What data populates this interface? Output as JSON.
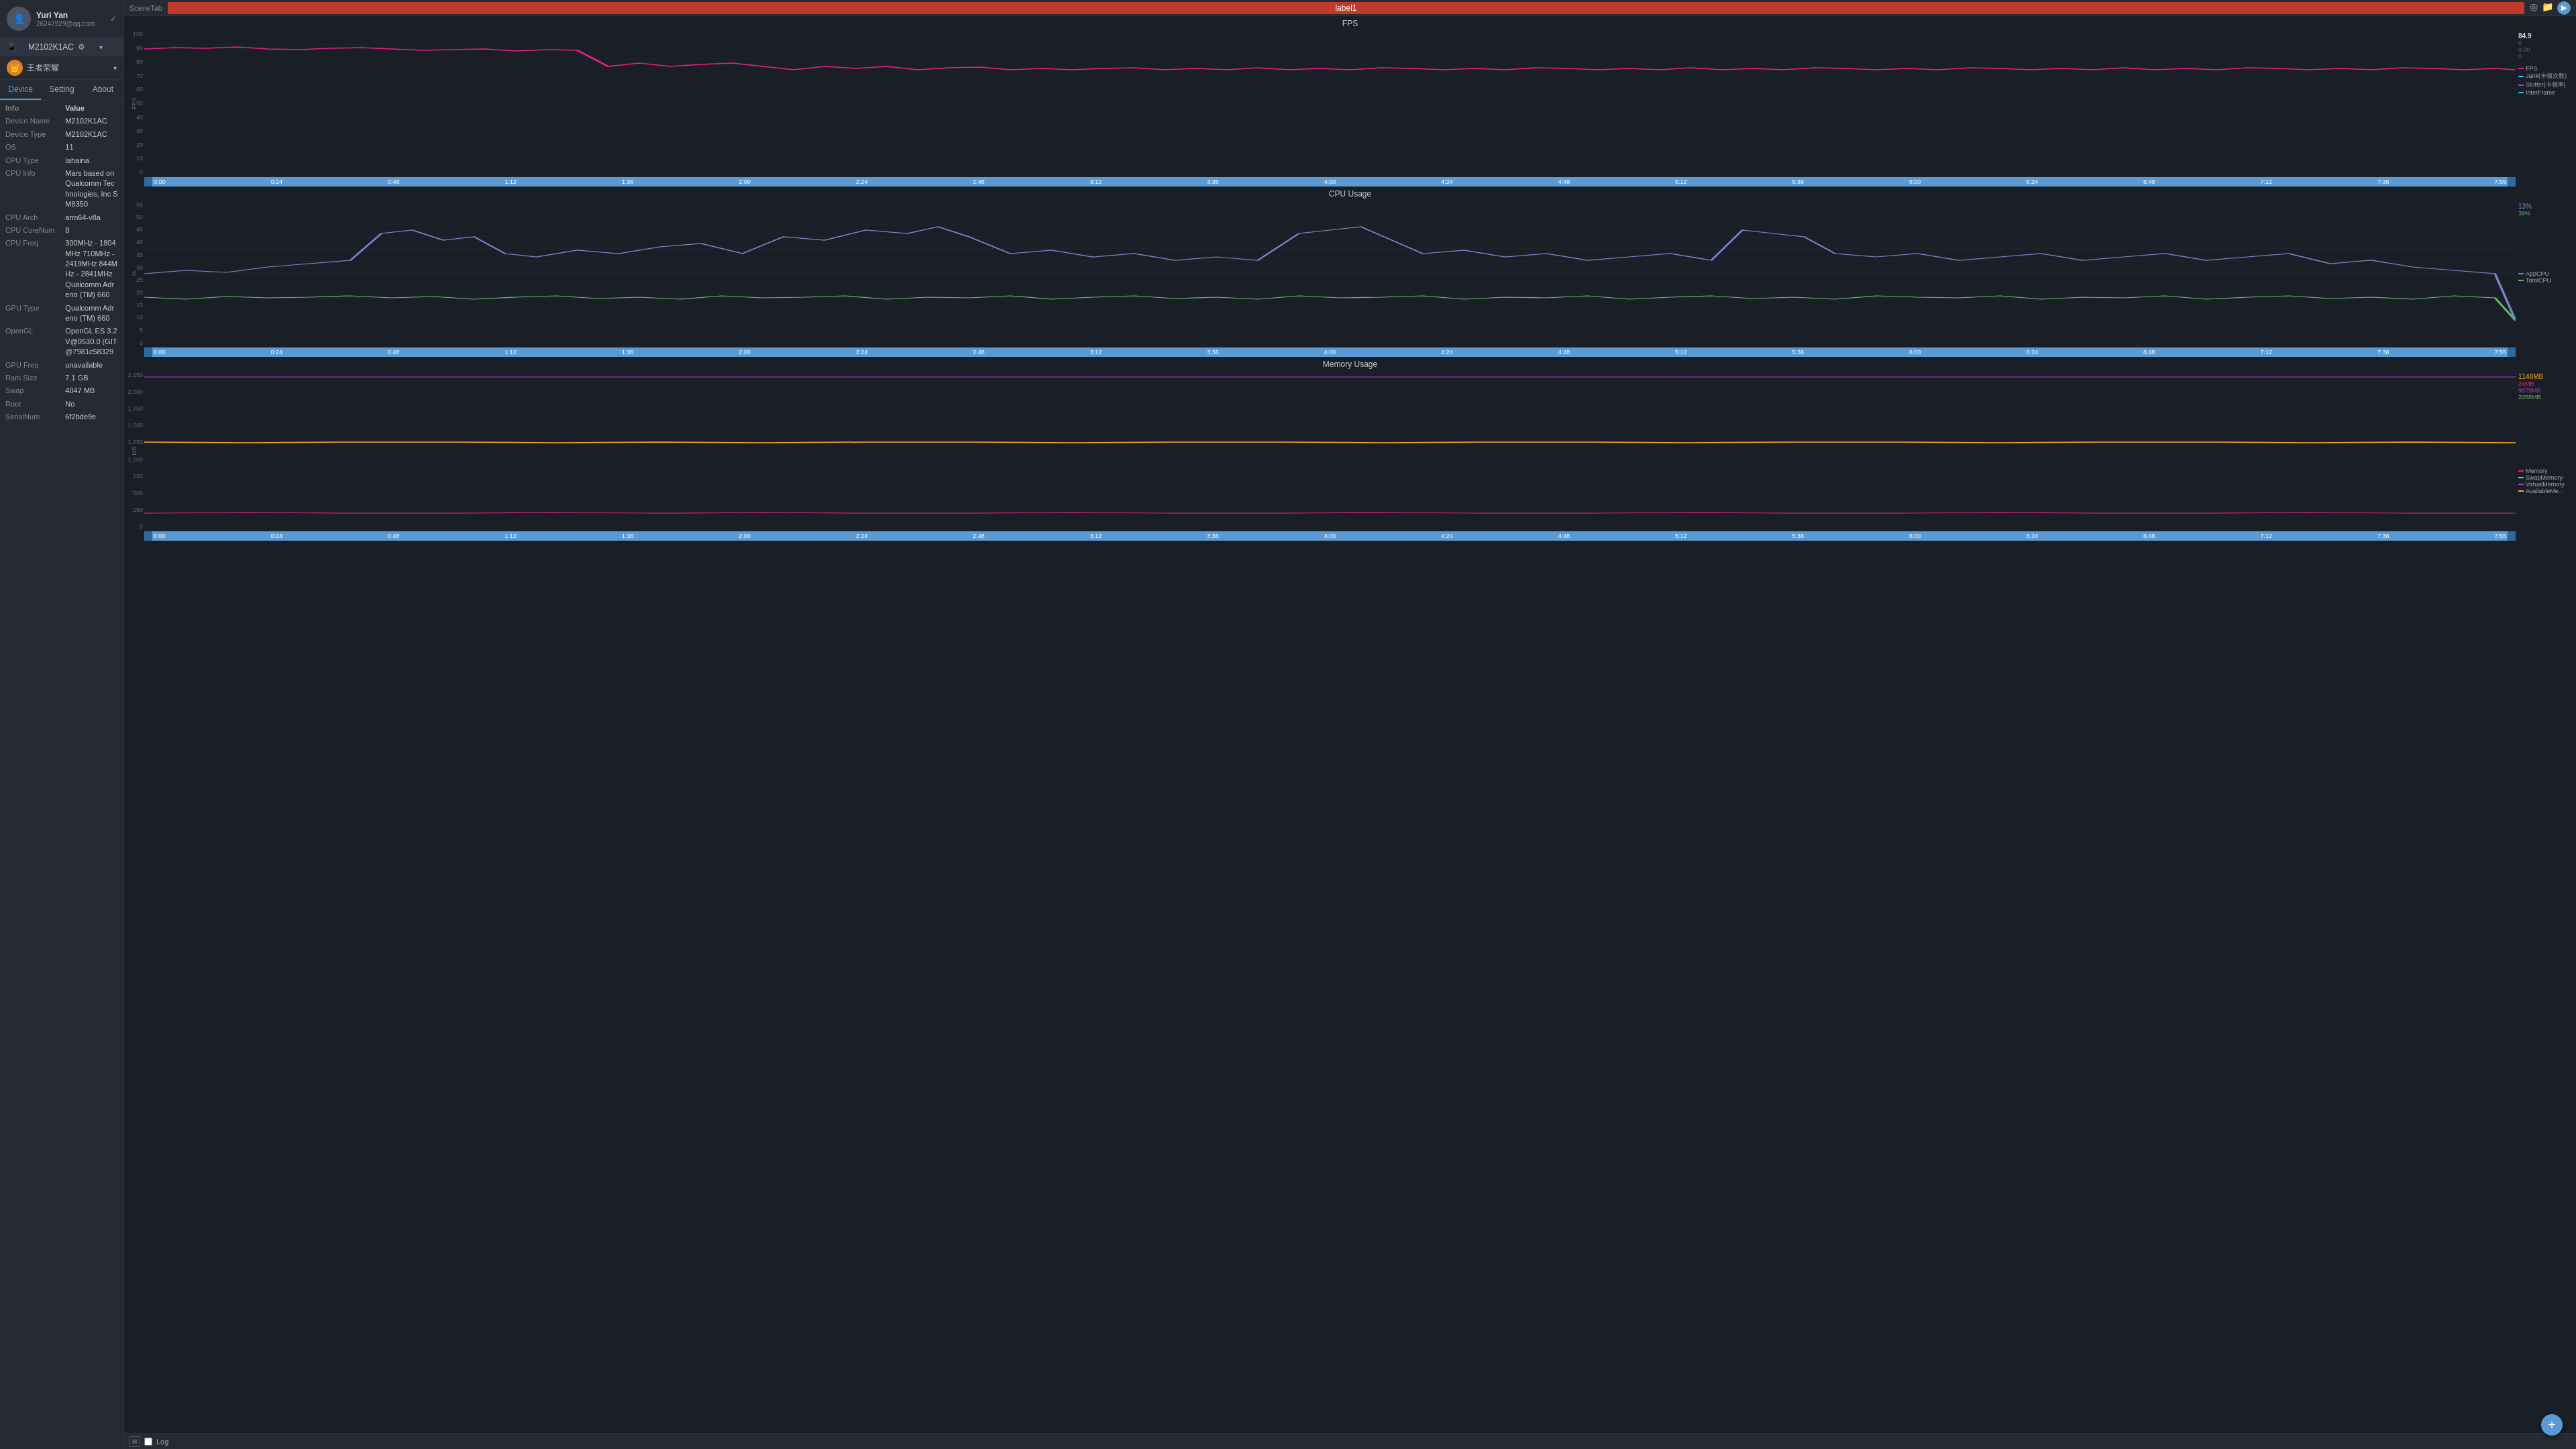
{
  "sidebar": {
    "user": {
      "name": "Yuri Yan",
      "email": "26247929@qq.com",
      "verified": true
    },
    "device": {
      "label": "M2102K1AC",
      "icon": "settings-icon"
    },
    "profile": {
      "name": "王者荣耀",
      "icon": "crown-icon"
    },
    "tabs": [
      {
        "id": "device",
        "label": "Device",
        "active": true
      },
      {
        "id": "setting",
        "label": "Setting",
        "active": false
      },
      {
        "id": "about",
        "label": "About",
        "active": false
      }
    ],
    "info": {
      "section_label": "Info",
      "value_label": "Value",
      "rows": [
        {
          "key": "Device Name",
          "value": "M2102K1AC"
        },
        {
          "key": "Device Type",
          "value": "M2102K1AC"
        },
        {
          "key": "OS",
          "value": "11"
        },
        {
          "key": "CPU Type",
          "value": "lahaina"
        },
        {
          "key": "CPU Info",
          "value": "Mars based on Qualcomm Technologies, Inc SM8350"
        },
        {
          "key": "CPU Arch",
          "value": "arm64-v8a"
        },
        {
          "key": "CPU CoreNum",
          "value": "8"
        },
        {
          "key": "CPU Freq",
          "value": "300MHz - 1804MHz\n710MHz - 2419MHz\n844MHz - 2841MHz\nQualcomm Adreno (TM) 660"
        },
        {
          "key": "GPU Type",
          "value": "Qualcomm Adreno (TM) 660"
        },
        {
          "key": "OpenGL",
          "value": "OpenGL ES 3.2\nV@0530.0 (GIT@7981c58329"
        },
        {
          "key": "GPU Freq",
          "value": "unavailable"
        },
        {
          "key": "Ram Size",
          "value": "7.1 GB"
        },
        {
          "key": "Swap",
          "value": "4047 MB"
        },
        {
          "key": "Root",
          "value": "No"
        },
        {
          "key": "SerialNum",
          "value": "6f2bde9e"
        }
      ]
    }
  },
  "header": {
    "scene_tab_label": "SceneTab",
    "label1": "label1",
    "icons": [
      "locate-icon",
      "folder-icon",
      "play-icon"
    ]
  },
  "fps_chart": {
    "title": "FPS",
    "y_labels": [
      "100",
      "90",
      "80",
      "70",
      "60",
      "50",
      "40",
      "30",
      "20",
      "10",
      "0"
    ],
    "x_labels": [
      "0:00",
      "0:24",
      "0:48",
      "1:12",
      "1:36",
      "2:00",
      "2:24",
      "2:48",
      "3:12",
      "3:36",
      "4:00",
      "4:24",
      "4:48",
      "5:12",
      "5:36",
      "6:00",
      "6:24",
      "6:48",
      "7:12",
      "7:36",
      "7:55"
    ],
    "current_values": {
      "top_right": [
        "84.9",
        "0",
        "0.00",
        "0"
      ]
    },
    "legend": [
      {
        "label": "FPS",
        "color": "#e91e8c"
      },
      {
        "label": "Jank(卡顿次数)",
        "color": "#4fc3f7"
      },
      {
        "label": "Stutter(卡顿率)",
        "color": "#ab47bc"
      },
      {
        "label": "InterFrame",
        "color": "#26c6da"
      }
    ],
    "axis_label": "FPS"
  },
  "cpu_chart": {
    "title": "CPU Usage",
    "y_labels": [
      "55",
      "50",
      "45",
      "40",
      "35",
      "30",
      "25",
      "20",
      "15",
      "10",
      "5",
      "0"
    ],
    "x_labels": [
      "0:00",
      "0:24",
      "0:48",
      "1:12",
      "1:36",
      "2:00",
      "2:24",
      "2:48",
      "3:12",
      "3:36",
      "4:00",
      "4:24",
      "4:48",
      "5:12",
      "5:36",
      "6:00",
      "6:24",
      "6:48",
      "7:12",
      "7:36",
      "7:55"
    ],
    "current_values": {
      "app_cpu": "13%",
      "total_cpu": "39%"
    },
    "legend": [
      {
        "label": "AppCPU",
        "color": "#7986cb"
      },
      {
        "label": "TotalCPU",
        "color": "#66bb6a"
      }
    ],
    "axis_label": "%"
  },
  "memory_chart": {
    "title": "Memory Usage",
    "y_labels": [
      "2,250",
      "2,000",
      "1,750",
      "1,500",
      "1,250",
      "1,000",
      "750",
      "500",
      "250",
      "0"
    ],
    "x_labels": [
      "0:00",
      "0:24",
      "0:48",
      "1:12",
      "1:36",
      "2:00",
      "2:24",
      "2:48",
      "3:12",
      "3:36",
      "4:00",
      "4:24",
      "4:48",
      "5:12",
      "5:36",
      "6:00",
      "6:24",
      "6:48",
      "7:12",
      "7:36",
      "7:55"
    ],
    "current_values": {
      "memory": "1148MB",
      "swap": "24MB",
      "virtual": "9079MB",
      "available": "2058MB"
    },
    "legend": [
      {
        "label": "Memory",
        "color": "#e91e8c"
      },
      {
        "label": "SwapMemory",
        "color": "#4fc3f7"
      },
      {
        "label": "VirtualMemory",
        "color": "#ab47bc"
      },
      {
        "label": "AvailableMe...",
        "color": "#ffa726"
      }
    ],
    "axis_label": "MB"
  },
  "bottom": {
    "log_label": "Log"
  }
}
